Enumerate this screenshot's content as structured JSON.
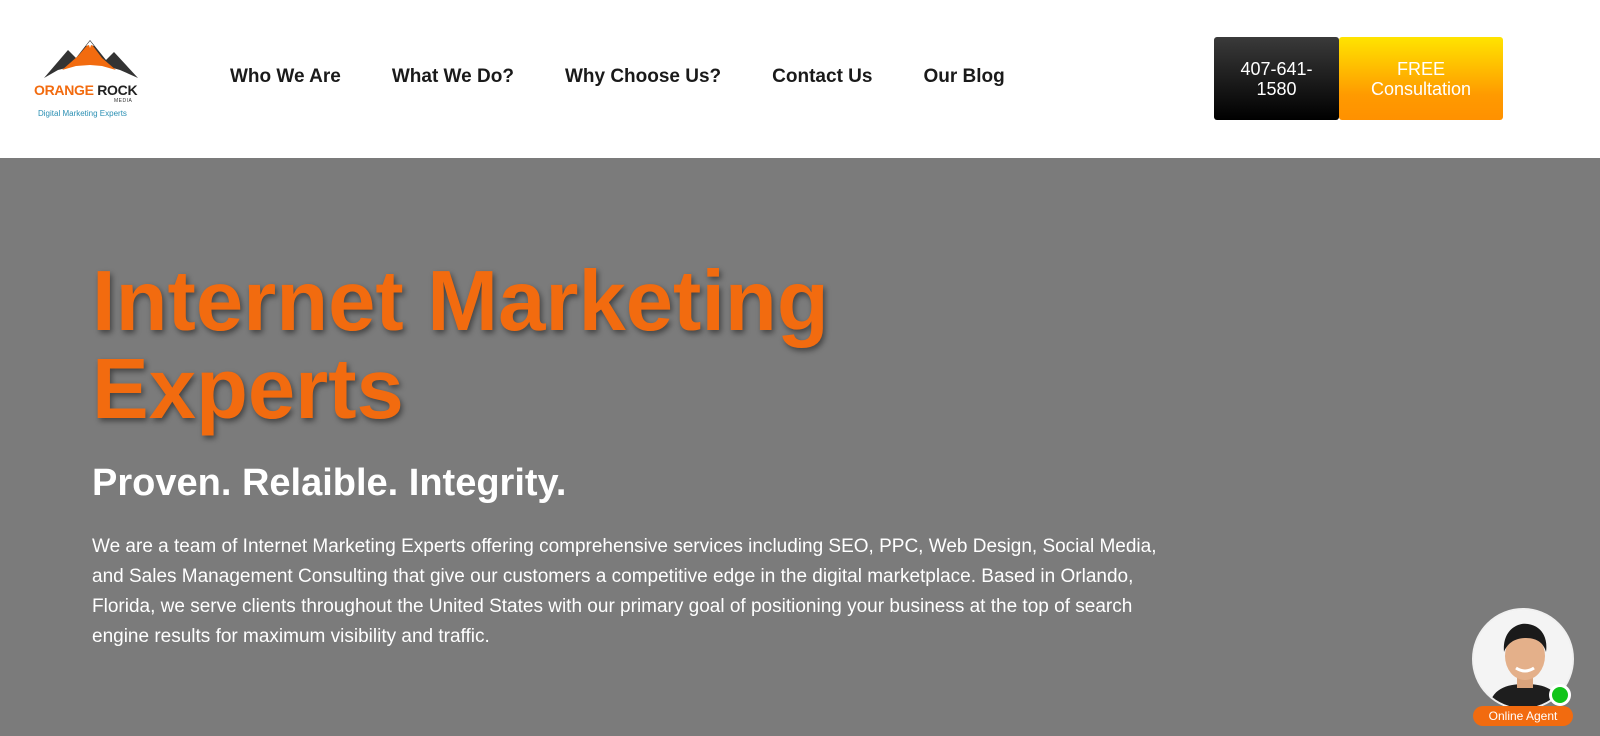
{
  "brand": {
    "logo_word_orange": "ORANGE",
    "logo_word_dark": "ROCK",
    "logo_sub": "MEDIA",
    "tagline": "Digital Marketing Experts",
    "accent_color": "#f26b0f"
  },
  "nav": {
    "items": [
      {
        "label": "Who We Are"
      },
      {
        "label": "What We Do?"
      },
      {
        "label": "Why Choose Us?"
      },
      {
        "label": "Contact Us"
      },
      {
        "label": "Our Blog"
      }
    ]
  },
  "header_buttons": {
    "phone": "407-641-1580",
    "cta": "FREE Consultation"
  },
  "hero": {
    "title": "Internet Marketing Experts",
    "subtitle": "Proven. Relaible. Integrity.",
    "body": "We are a team of Internet Marketing Experts offering comprehensive services including SEO, PPC, Web Design, Social Media, and Sales Management Consulting that give our customers a competitive edge in the digital marketplace. Based in Orlando, Florida, we serve clients throughout the United States with our primary goal of positioning your business at the top of search engine results for maximum visibility and traffic."
  },
  "chat_widget": {
    "label": "Online Agent",
    "status_color": "#11c41a"
  }
}
